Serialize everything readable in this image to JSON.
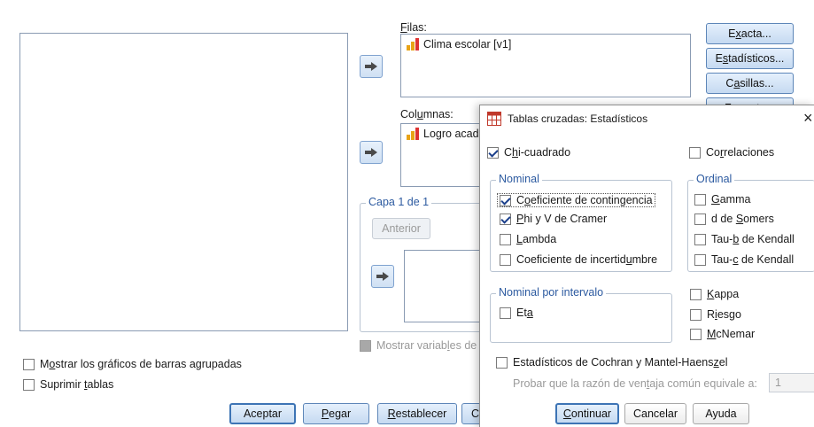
{
  "main": {
    "rows_label_pre": "",
    "rows_label_ul": "F",
    "rows_label_post": "ilas:",
    "rows_item": "Clima escolar [v1]",
    "cols_label_pre": "Col",
    "cols_label_ul": "u",
    "cols_label_post": "mnas:",
    "cols_item": "Logro acad",
    "layer_label": "Capa 1 de 1",
    "prev_button": "Anterior",
    "show_layer_vars_pre": "Mostrar variab",
    "show_layer_vars_ul": "l",
    "show_layer_vars_post": "es de",
    "clustered_bars_pre": "M",
    "clustered_bars_ul": "o",
    "clustered_bars_post": "strar los gráficos de barras agrupadas",
    "suppress_tables_pre": "Suprimir ",
    "suppress_tables_ul": "t",
    "suppress_tables_post": "ablas",
    "side_buttons": {
      "exact_pre": "E",
      "exact_ul": "x",
      "exact_post": "acta...",
      "stats_pre": "E",
      "stats_ul": "s",
      "stats_post": "tadísticos...",
      "cells_pre": "C",
      "cells_ul": "a",
      "cells_post": "sillas...",
      "format": "Formato..."
    },
    "bottom_buttons": {
      "ok": "Aceptar",
      "paste_ul": "P",
      "paste_post": "egar",
      "reset_ul": "R",
      "reset_post": "establecer",
      "cancel_partial": "C"
    }
  },
  "dialog": {
    "title": "Tablas cruzadas: Estadísticos",
    "close": "×",
    "chisq_pre": "C",
    "chisq_ul": "h",
    "chisq_post": "i-cuadrado",
    "chisq_checked": true,
    "corr_pre": "Co",
    "corr_ul": "r",
    "corr_post": "relaciones",
    "nominal_title": "Nominal",
    "nominal_items": [
      {
        "pre": "C",
        "ul": "o",
        "post": "eficiente de contingencia",
        "checked": true
      },
      {
        "pre": "",
        "ul": "P",
        "post": "hi y V de Cramer",
        "checked": true
      },
      {
        "pre": "",
        "ul": "L",
        "post": "ambda",
        "checked": false
      },
      {
        "pre": "Coeficiente de incertid",
        "ul": "u",
        "post": "mbre",
        "checked": false
      }
    ],
    "ordinal_title": "Ordinal",
    "ordinal_items": [
      {
        "pre": "",
        "ul": "G",
        "post": "amma",
        "checked": false
      },
      {
        "pre": "d de ",
        "ul": "S",
        "post": "omers",
        "checked": false
      },
      {
        "pre": "Tau-",
        "ul": "b",
        "post": " de Kendall",
        "checked": false
      },
      {
        "pre": "Tau-",
        "ul": "c",
        "post": " de Kendall",
        "checked": false
      }
    ],
    "interval_title": "Nominal por intervalo",
    "eta_pre": "Et",
    "eta_ul": "a",
    "eta_post": "",
    "kappa_ul": "K",
    "kappa_post": "appa",
    "risk_pre": "R",
    "risk_ul": "i",
    "risk_post": "esgo",
    "mcnemar_ul": "M",
    "mcnemar_post": "cNemar",
    "cochran_pre": "Estadísticos de Cochran y Mantel-Haens",
    "cochran_ul": "z",
    "cochran_post": "el",
    "odds_pre": "Probar que la razón de ven",
    "odds_ul": "t",
    "odds_post": "aja común equivale a:",
    "odds_value": "1",
    "continue_ul": "C",
    "continue_post": "ontinuar",
    "cancel": "Cancelar",
    "help": "Ayuda"
  },
  "colors": {
    "accent_blue": "#2c5aa0",
    "button_border": "#5d86b8",
    "dialog_bg": "#ffffff"
  }
}
